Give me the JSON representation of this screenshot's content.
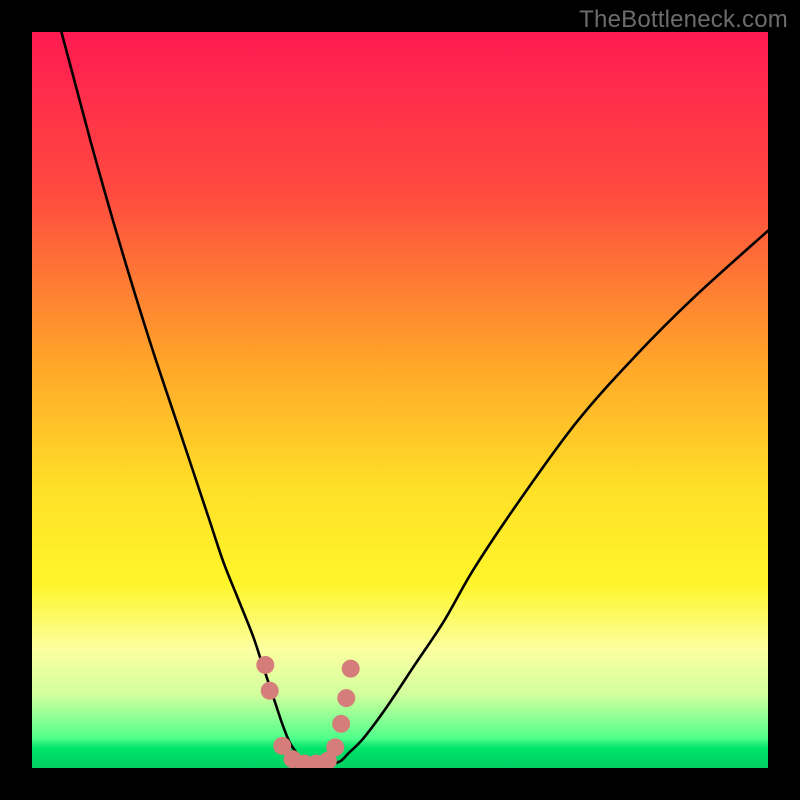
{
  "watermark": "TheBottleneck.com",
  "chart_data": {
    "type": "line",
    "title": "",
    "xlabel": "",
    "ylabel": "",
    "xlim": [
      0,
      100
    ],
    "ylim": [
      0,
      100
    ],
    "grid": false,
    "legend": false,
    "gradient_stops": [
      {
        "offset": 0,
        "color": "#ff1a52"
      },
      {
        "offset": 0.22,
        "color": "#ff4b3f"
      },
      {
        "offset": 0.45,
        "color": "#ffa629"
      },
      {
        "offset": 0.62,
        "color": "#ffe028"
      },
      {
        "offset": 0.75,
        "color": "#fff52a"
      },
      {
        "offset": 0.84,
        "color": "#fbffa1"
      },
      {
        "offset": 0.9,
        "color": "#d2ff9d"
      },
      {
        "offset": 0.96,
        "color": "#4fff8b"
      },
      {
        "offset": 1.0,
        "color": "#00e36a"
      }
    ],
    "green_zone": {
      "y_min": 0,
      "y_max": 4
    },
    "series": [
      {
        "name": "bottleneck-curve",
        "x": [
          0,
          4,
          8,
          12,
          16,
          20,
          24,
          26,
          28,
          30,
          31,
          32,
          33,
          34,
          35,
          36,
          37,
          38,
          39,
          40,
          41,
          42,
          43,
          45,
          48,
          52,
          56,
          60,
          66,
          74,
          82,
          90,
          100
        ],
        "y": [
          116,
          100,
          85,
          71,
          58,
          46,
          34,
          28,
          23,
          18,
          15,
          12,
          9,
          6,
          3.5,
          2,
          1,
          0.6,
          0.5,
          0.5,
          0.6,
          1,
          2,
          4,
          8,
          14,
          20,
          27,
          36,
          47,
          56,
          64,
          73
        ]
      },
      {
        "name": "markers",
        "type": "scatter",
        "color": "#d47d7a",
        "radius_px": 9,
        "x": [
          31.7,
          32.3,
          34.0,
          35.4,
          37.0,
          38.6,
          40.2,
          41.2,
          42.0,
          42.7,
          43.3
        ],
        "y": [
          14.0,
          10.5,
          3.0,
          1.2,
          0.6,
          0.6,
          1.0,
          2.8,
          6.0,
          9.5,
          13.5
        ]
      }
    ]
  }
}
